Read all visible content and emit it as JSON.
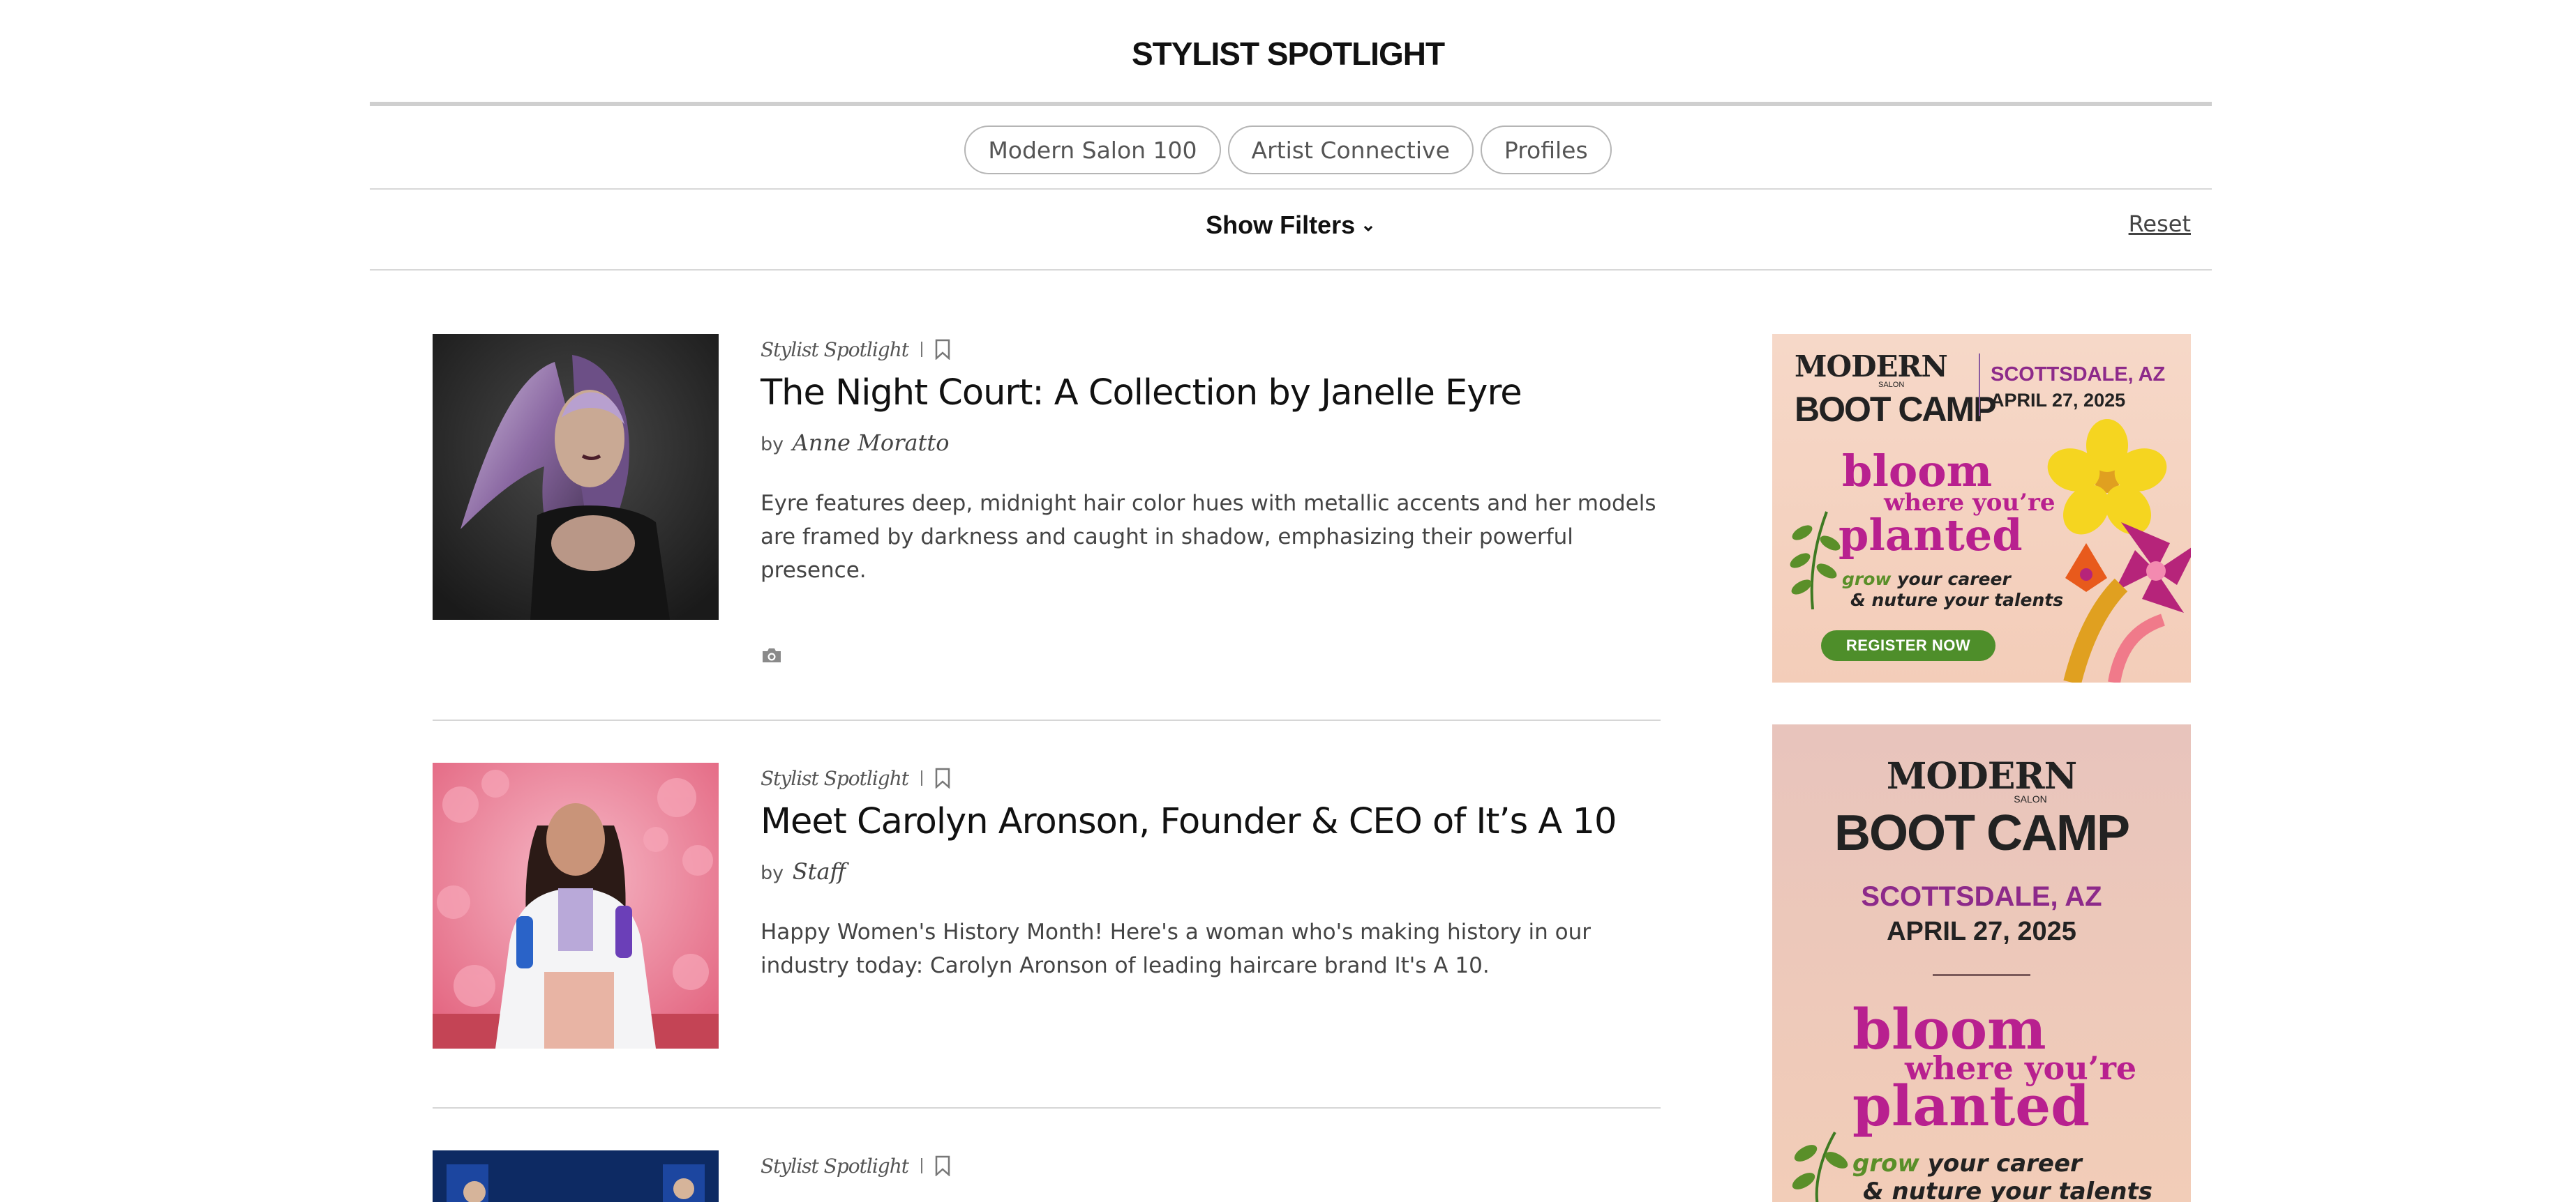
{
  "header": {
    "title": "STYLIST SPOTLIGHT"
  },
  "pills": [
    {
      "label": "Modern Salon 100"
    },
    {
      "label": "Artist Connective"
    },
    {
      "label": "Profiles"
    }
  ],
  "filters": {
    "show_label": "Show Filters",
    "reset_label": "Reset"
  },
  "articles": [
    {
      "kicker": "Stylist Spotlight",
      "title": "The Night Court: A Collection by Janelle Eyre",
      "by": "by",
      "author": "Anne Moratto",
      "excerpt": "Eyre features deep, midnight hair color hues with metallic accents and her models are framed by darkness and caught in shadow, emphasizing their powerful presence.",
      "has_gallery": true
    },
    {
      "kicker": "Stylist Spotlight",
      "title": "Meet Carolyn Aronson, Founder & CEO of It’s A 10",
      "by": "by",
      "author": "Staff",
      "excerpt": "Happy Women's History Month! Here's a woman who's making history in our industry today: Carolyn Aronson of leading haircare brand It's A 10."
    },
    {
      "kicker": "Stylist Spotlight"
    }
  ],
  "ads": [
    {
      "brand_top": "MODERN",
      "brand_small": "SALON",
      "brand_bottom": "BOOT CAMP",
      "city": "SCOTTSDALE, AZ",
      "date": "APRIL 27, 2025",
      "headline_1": "bloom",
      "headline_2": "where you’re",
      "headline_3": "planted",
      "sub_grow": "grow",
      "sub_1": "your career",
      "sub_2": "& nuture your talents",
      "cta": "REGISTER NOW"
    },
    {
      "brand_top": "MODERN",
      "brand_small": "SALON",
      "brand_bottom": "BOOT CAMP",
      "city": "SCOTTSDALE, AZ",
      "date": "APRIL 27, 2025",
      "headline_1": "bloom",
      "headline_2": "where you’re",
      "headline_3": "planted",
      "sub_grow": "grow",
      "sub_1": "your career",
      "sub_2": "& nuture your talents"
    }
  ],
  "colors": {
    "accent_magenta": "#b8208f",
    "accent_green": "#4e8e2a",
    "text_dark": "#111111"
  }
}
